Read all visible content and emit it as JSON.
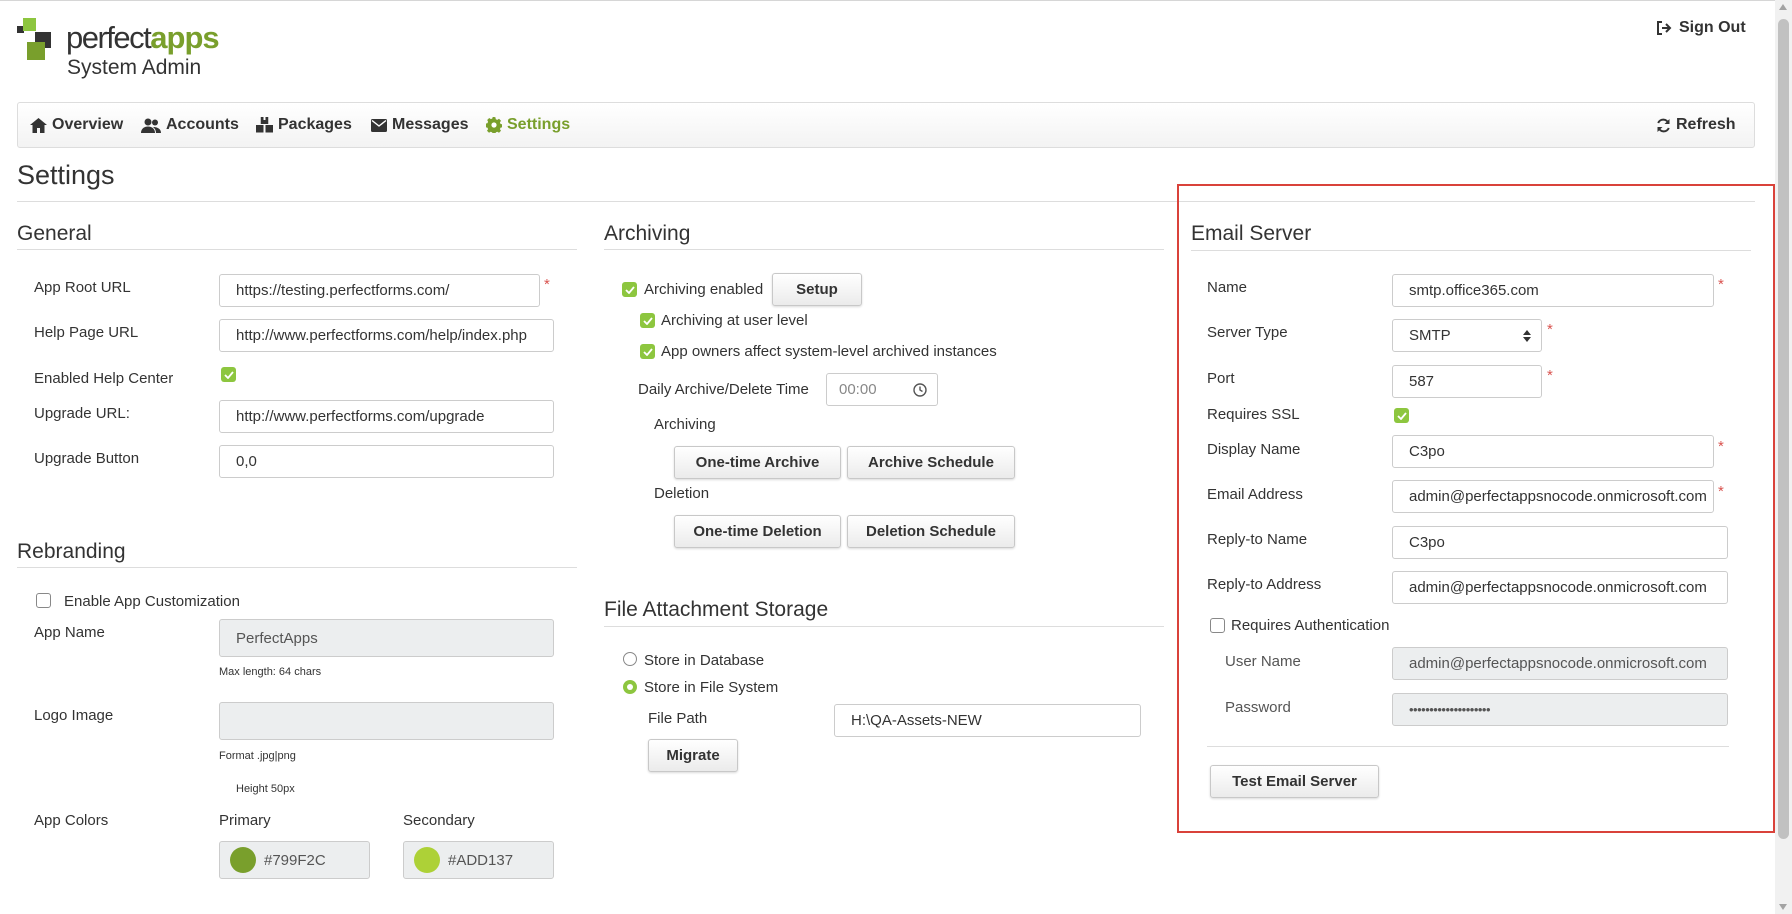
{
  "header": {
    "brand_left": "perfect",
    "brand_right": "apps",
    "subtitle": "System Admin",
    "signout_label": "Sign Out"
  },
  "nav": {
    "items": [
      {
        "label": "Overview",
        "icon": "home-icon"
      },
      {
        "label": "Accounts",
        "icon": "users-icon"
      },
      {
        "label": "Packages",
        "icon": "packages-icon"
      },
      {
        "label": "Messages",
        "icon": "envelope-icon"
      },
      {
        "label": "Settings",
        "icon": "gear-icon"
      }
    ],
    "refresh_label": "Refresh"
  },
  "page_title": "Settings",
  "general": {
    "title": "General",
    "app_root_url_label": "App Root URL",
    "app_root_url_value": "https://testing.perfectforms.com/",
    "help_page_url_label": "Help Page URL",
    "help_page_url_value": "http://www.perfectforms.com/help/index.php",
    "enabled_help_center_label": "Enabled Help Center",
    "upgrade_url_label": "Upgrade URL:",
    "upgrade_url_value": "http://www.perfectforms.com/upgrade",
    "upgrade_button_label": "Upgrade Button",
    "upgrade_button_value": "0,0"
  },
  "rebranding": {
    "title": "Rebranding",
    "enable_customization_label": "Enable App Customization",
    "app_name_label": "App Name",
    "app_name_value": "PerfectApps",
    "app_name_hint": "Max length: 64 chars",
    "logo_image_label": "Logo Image",
    "logo_format_hint": "Format .jpg|png",
    "logo_height_hint": "Height 50px",
    "app_colors_label": "App Colors",
    "primary_label": "Primary",
    "primary_value": "#799F2C",
    "secondary_label": "Secondary",
    "secondary_value": "#ADD137"
  },
  "archiving": {
    "title": "Archiving",
    "archiving_enabled_label": "Archiving enabled",
    "setup_button": "Setup",
    "archiving_user_level_label": "Archiving at user level",
    "app_owners_label": "App owners affect system-level archived instances",
    "daily_time_label": "Daily Archive/Delete Time",
    "daily_time_value": "00:00",
    "archiving_sub_label": "Archiving",
    "one_time_archive": "One-time Archive",
    "archive_schedule": "Archive Schedule",
    "deletion_sub_label": "Deletion",
    "one_time_deletion": "One-time Deletion",
    "deletion_schedule": "Deletion Schedule"
  },
  "file_storage": {
    "title": "File Attachment Storage",
    "store_db_label": "Store in Database",
    "store_fs_label": "Store in File System",
    "file_path_label": "File Path",
    "file_path_value": "H:\\QA-Assets-NEW",
    "migrate_button": "Migrate"
  },
  "email_server": {
    "title": "Email Server",
    "name_label": "Name",
    "name_value": "smtp.office365.com",
    "server_type_label": "Server Type",
    "server_type_value": "SMTP",
    "port_label": "Port",
    "port_value": "587",
    "requires_ssl_label": "Requires SSL",
    "display_name_label": "Display Name",
    "display_name_value": "C3po",
    "email_address_label": "Email Address",
    "email_address_value": "admin@perfectappsnocode.onmicrosoft.com",
    "reply_to_name_label": "Reply-to Name",
    "reply_to_name_value": "C3po",
    "reply_to_address_label": "Reply-to Address",
    "reply_to_address_value": "admin@perfectappsnocode.onmicrosoft.com",
    "requires_auth_label": "Requires Authentication",
    "user_name_label": "User Name",
    "user_name_value": "admin@perfectappsnocode.onmicrosoft.com",
    "password_label": "Password",
    "password_value": "••••••••••••••••••••",
    "test_button": "Test Email Server"
  },
  "colors": {
    "accent": "#799F2C",
    "secondary": "#ADD137",
    "check_green": "#8DC63F",
    "required_red": "#d9534f",
    "highlight_red": "#d9423a"
  }
}
